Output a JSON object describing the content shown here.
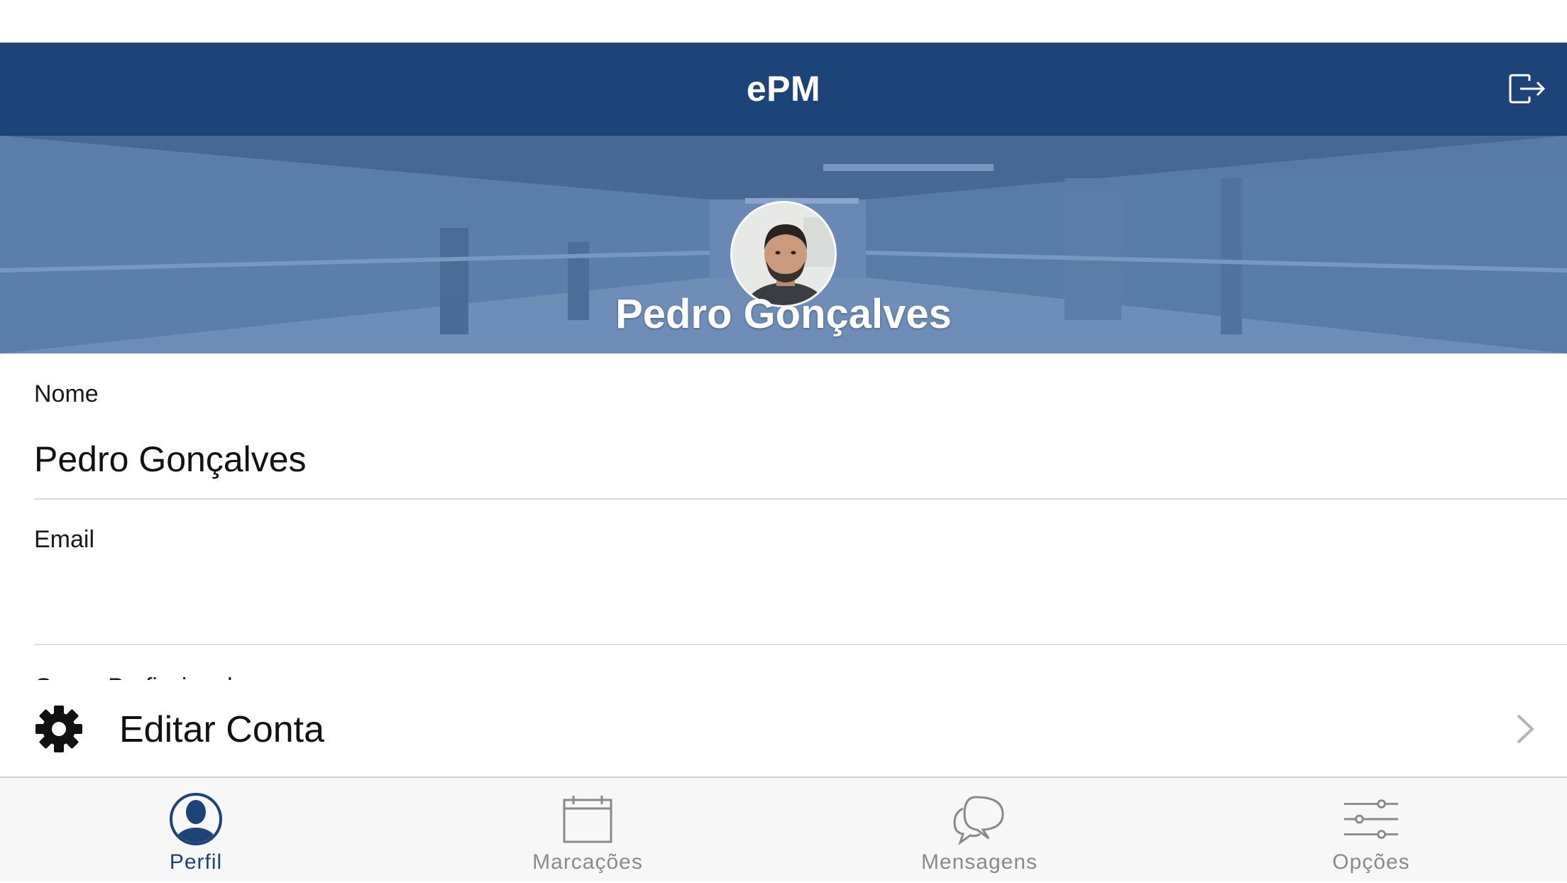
{
  "app": {
    "title": "ePM"
  },
  "header": {
    "logout_icon": "logout-icon"
  },
  "profile": {
    "display_name": "Pedro Gonçalves",
    "avatar_icon": "user-photo"
  },
  "fields": [
    {
      "label": "Nome",
      "value": "Pedro Gonçalves"
    },
    {
      "label": "Email",
      "value": ""
    },
    {
      "label": "Grupo Profissional",
      "value": ""
    }
  ],
  "edit_account": {
    "label": "Editar Conta",
    "icon": "gear-icon"
  },
  "tabs": [
    {
      "label": "Perfil",
      "icon": "person-icon",
      "active": true
    },
    {
      "label": "Marcações",
      "icon": "calendar-icon",
      "active": false
    },
    {
      "label": "Mensagens",
      "icon": "chat-bubbles-icon",
      "active": false
    },
    {
      "label": "Opções",
      "icon": "sliders-icon",
      "active": false
    }
  ],
  "colors": {
    "navbar": "#1d4479",
    "hero_tint": "#587aa6",
    "tab_active": "#1d4479",
    "tab_inactive": "#8a8a8a"
  }
}
